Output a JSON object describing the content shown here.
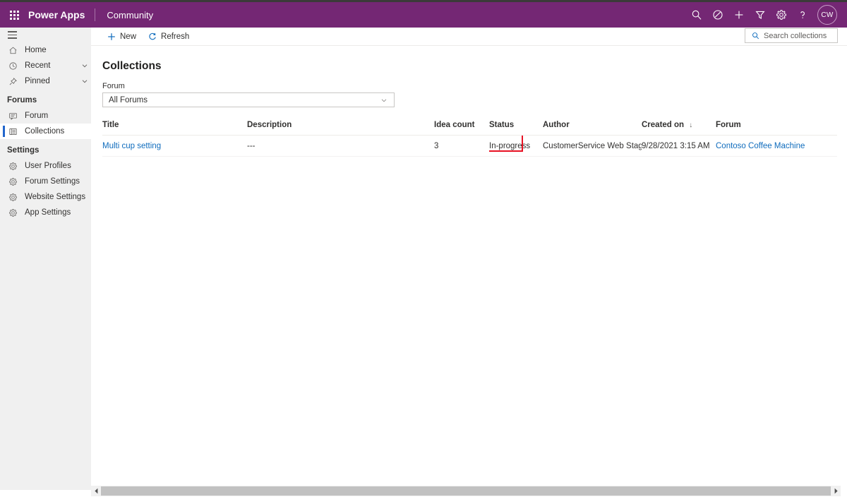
{
  "header": {
    "waffle_icon": "app-launcher-icon",
    "brand": "Power Apps",
    "app_name": "Community",
    "icons": [
      {
        "name": "search-icon",
        "glyph": "search"
      },
      {
        "name": "environment-icon",
        "glyph": "circle-slash"
      },
      {
        "name": "add-icon",
        "glyph": "plus"
      },
      {
        "name": "filter-icon",
        "glyph": "funnel"
      },
      {
        "name": "settings-gear-icon",
        "glyph": "gear"
      },
      {
        "name": "help-icon",
        "glyph": "question"
      }
    ],
    "avatar_initials": "CW",
    "brand_color": "#742774"
  },
  "sidebar": {
    "hamburger_icon": "hamburger-menu-icon",
    "items": [
      {
        "label": "Home",
        "icon": "home-icon",
        "chevron": false,
        "selected": false
      },
      {
        "label": "Recent",
        "icon": "clock-icon",
        "chevron": true,
        "selected": false
      },
      {
        "label": "Pinned",
        "icon": "pin-icon",
        "chevron": true,
        "selected": false
      }
    ],
    "forums_section": "Forums",
    "forums_items": [
      {
        "label": "Forum",
        "icon": "chat-bubble-icon",
        "selected": false
      },
      {
        "label": "Collections",
        "icon": "list-icon",
        "selected": true
      }
    ],
    "settings_section": "Settings",
    "settings_items": [
      {
        "label": "User Profiles",
        "icon": "gear-icon"
      },
      {
        "label": "Forum Settings",
        "icon": "gear-icon"
      },
      {
        "label": "Website Settings",
        "icon": "gear-icon"
      },
      {
        "label": "App Settings",
        "icon": "gear-icon"
      }
    ],
    "selected_indicator_color": "#2266cc"
  },
  "command_bar": {
    "new_label": "New",
    "refresh_label": "Refresh",
    "new_icon": "plus-icon",
    "refresh_icon": "refresh-icon"
  },
  "search": {
    "placeholder": "Search collections",
    "value": "",
    "icon": "search-icon"
  },
  "page": {
    "title": "Collections",
    "filter_label": "Forum",
    "filter_value": "All Forums",
    "filter_chevron_icon": "chevron-down-icon"
  },
  "table": {
    "columns": [
      {
        "key": "title",
        "label": "Title",
        "sorted": false
      },
      {
        "key": "description",
        "label": "Description",
        "sorted": false
      },
      {
        "key": "idea_count",
        "label": "Idea count",
        "sorted": false
      },
      {
        "key": "status",
        "label": "Status",
        "sorted": false
      },
      {
        "key": "author",
        "label": "Author",
        "sorted": false
      },
      {
        "key": "created_on",
        "label": "Created on",
        "sorted": true,
        "sort_arrow": "↓"
      },
      {
        "key": "forum",
        "label": "Forum",
        "sorted": false
      }
    ],
    "rows": [
      {
        "title": "Multi cup setting",
        "description": "---",
        "idea_count": "3",
        "status": "In-progress",
        "author": "CustomerService Web Staging",
        "created_on": "9/28/2021 3:15 AM",
        "forum": "Contoso Coffee Machine"
      }
    ],
    "highlight": {
      "target": "status",
      "color": "#e81123"
    }
  },
  "scrollbar": {
    "left_arrow_icon": "caret-left-icon",
    "right_arrow_icon": "caret-right-icon",
    "thumb_name": "horizontal-scroll-thumb"
  }
}
